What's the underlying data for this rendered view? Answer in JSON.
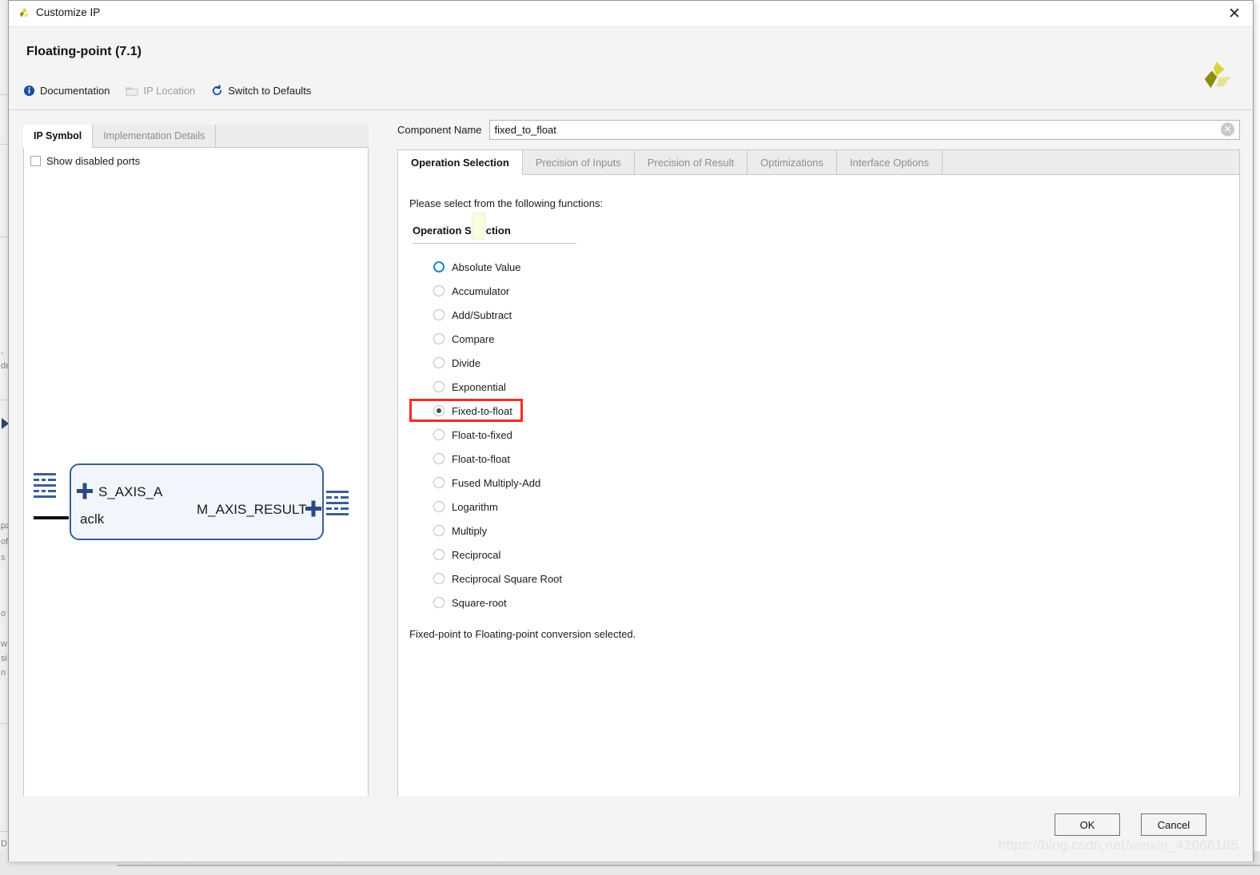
{
  "window": {
    "title": "Customize IP",
    "logo_icon": "xilinx-logo-icon",
    "close_icon": "close-icon"
  },
  "header": {
    "ip_title": "Floating-point (7.1)",
    "brand_logo_icon": "xilinx-pinwheel-icon",
    "actions": [
      {
        "label": "Documentation",
        "icon": "info-icon",
        "enabled": true
      },
      {
        "label": "IP Location",
        "icon": "folder-icon",
        "enabled": false
      },
      {
        "label": "Switch to Defaults",
        "icon": "refresh-icon",
        "enabled": true
      }
    ]
  },
  "left_panel": {
    "tabs": [
      {
        "label": "IP Symbol",
        "active": true
      },
      {
        "label": "Implementation Details",
        "active": false
      }
    ],
    "show_disabled_ports": {
      "label": "Show disabled ports",
      "checked": false
    },
    "symbol": {
      "input_bus_label": "S_AXIS_A",
      "clock_label": "aclk",
      "output_bus_label": "M_AXIS_RESULT",
      "bus_expand_icon": "plus-icon",
      "port_connector_icon": "bus-port-icon",
      "block_fill": "#f2f6fc",
      "block_stroke": "#3a5f99"
    }
  },
  "right_panel": {
    "component_name": {
      "label": "Component Name",
      "value": "fixed_to_float",
      "placeholder": "",
      "clear_icon": "clear-circle-icon"
    },
    "tabs": [
      {
        "label": "Operation Selection",
        "active": true
      },
      {
        "label": "Precision of Inputs",
        "active": false
      },
      {
        "label": "Precision of Result",
        "active": false
      },
      {
        "label": "Optimizations",
        "active": false
      },
      {
        "label": "Interface Options",
        "active": false
      }
    ],
    "prompt": "Please select from the following functions:",
    "group_title": "Operation Selection",
    "operations": [
      {
        "label": "Absolute Value",
        "checked": false,
        "focused": true
      },
      {
        "label": "Accumulator",
        "checked": false,
        "focused": false
      },
      {
        "label": "Add/Subtract",
        "checked": false,
        "focused": false
      },
      {
        "label": "Compare",
        "checked": false,
        "focused": false
      },
      {
        "label": "Divide",
        "checked": false,
        "focused": false
      },
      {
        "label": "Exponential",
        "checked": false,
        "focused": false
      },
      {
        "label": "Fixed-to-float",
        "checked": true,
        "focused": false
      },
      {
        "label": "Float-to-fixed",
        "checked": false,
        "focused": false
      },
      {
        "label": "Float-to-float",
        "checked": false,
        "focused": false
      },
      {
        "label": "Fused Multiply-Add",
        "checked": false,
        "focused": false
      },
      {
        "label": "Logarithm",
        "checked": false,
        "focused": false
      },
      {
        "label": "Multiply",
        "checked": false,
        "focused": false
      },
      {
        "label": "Reciprocal",
        "checked": false,
        "focused": false
      },
      {
        "label": "Reciprocal Square Root",
        "checked": false,
        "focused": false
      },
      {
        "label": "Square-root",
        "checked": false,
        "focused": false
      }
    ],
    "status_text": "Fixed-point to Floating-point conversion selected.",
    "annotation_color": "#fa2b22"
  },
  "footer": {
    "ok_label": "OK",
    "cancel_label": "Cancel"
  },
  "watermark": "https://blog.csdn.net/weixin_42066185",
  "background_fragments": {
    "left": [
      "-",
      "de",
      "pa",
      "of",
      "s",
      "o",
      "w",
      "si",
      "n",
      "D"
    ]
  }
}
